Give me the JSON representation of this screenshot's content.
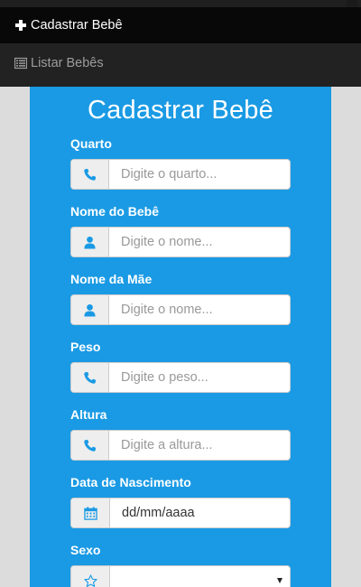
{
  "nav": {
    "items": [
      {
        "label": "Cadastrar Bebê",
        "icon": "plus-icon",
        "active": true
      },
      {
        "label": "Listar Bebês",
        "icon": "list-icon",
        "active": false
      }
    ]
  },
  "form": {
    "title": "Cadastrar Bebê",
    "fields": [
      {
        "label": "Quarto",
        "placeholder": "Digite o quarto...",
        "icon": "phone-icon"
      },
      {
        "label": "Nome do Bebê",
        "placeholder": "Digite o nome...",
        "icon": "user-icon"
      },
      {
        "label": "Nome da Mãe",
        "placeholder": "Digite o nome...",
        "icon": "user-icon"
      },
      {
        "label": "Peso",
        "placeholder": "Digite o peso...",
        "icon": "phone-icon"
      },
      {
        "label": "Altura",
        "placeholder": "Digite a altura...",
        "icon": "phone-icon"
      },
      {
        "label": "Data de Nascimento",
        "value": "dd/mm/aaaa",
        "icon": "calendar-icon"
      },
      {
        "label": "Sexo",
        "value": "",
        "icon": "star-icon"
      }
    ]
  },
  "colors": {
    "panel": "#1a9ae4",
    "navbar": "#222222",
    "icon": "#1a9ae4"
  }
}
